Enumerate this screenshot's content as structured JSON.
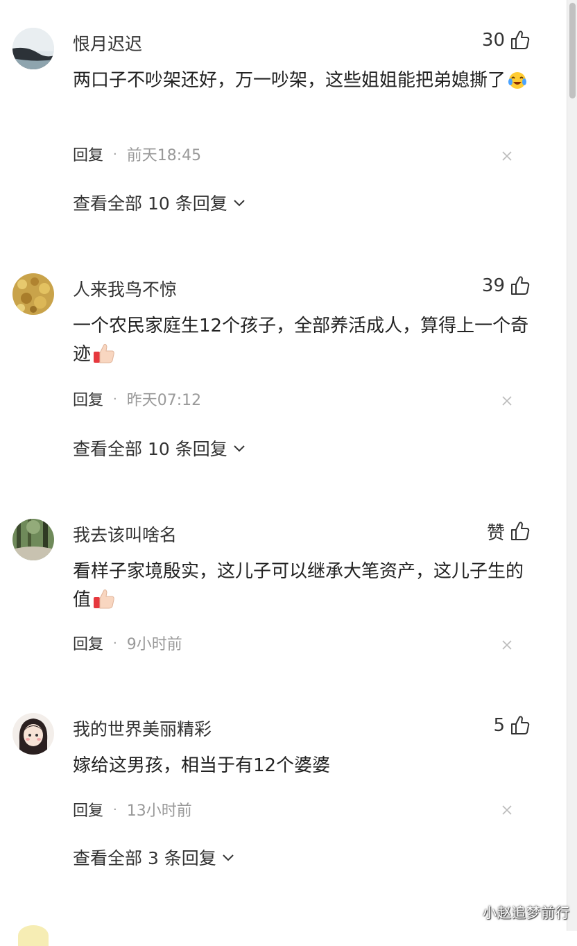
{
  "comments": [
    {
      "username": "恨月迟迟",
      "likes": "30",
      "text": "两口子不吵架还好，万一吵架，这些姐姐能把弟媳撕了",
      "emoji": "laughing-crying-emoji",
      "reply_label": "回复",
      "separator": "·",
      "time": "前天18:45",
      "view_replies": "查看全部 10 条回复"
    },
    {
      "username": "人来我鸟不惊",
      "likes": "39",
      "text": "一个农民家庭生12个孩子，全部养活成人，算得上一个奇迹",
      "emoji": "thumbs-up-emoji",
      "reply_label": "回复",
      "separator": "·",
      "time": "昨天07:12",
      "view_replies": "查看全部 10 条回复"
    },
    {
      "username": "我去该叫啥名",
      "likes": "赞",
      "text": "看样子家境殷实，这儿子可以继承大笔资产，这儿子生的值",
      "emoji": "thumbs-up-emoji",
      "reply_label": "回复",
      "separator": "·",
      "time": "9小时前"
    },
    {
      "username": "我的世界美丽精彩",
      "likes": "5",
      "text": "嫁给这男孩，相当于有12个婆婆",
      "reply_label": "回复",
      "separator": "·",
      "time": "13小时前",
      "view_replies": "查看全部 3 条回复"
    }
  ],
  "watermark": "小赵追梦前行",
  "colors": {
    "text": "#222222",
    "muted": "#999999",
    "background": "#ffffff"
  }
}
